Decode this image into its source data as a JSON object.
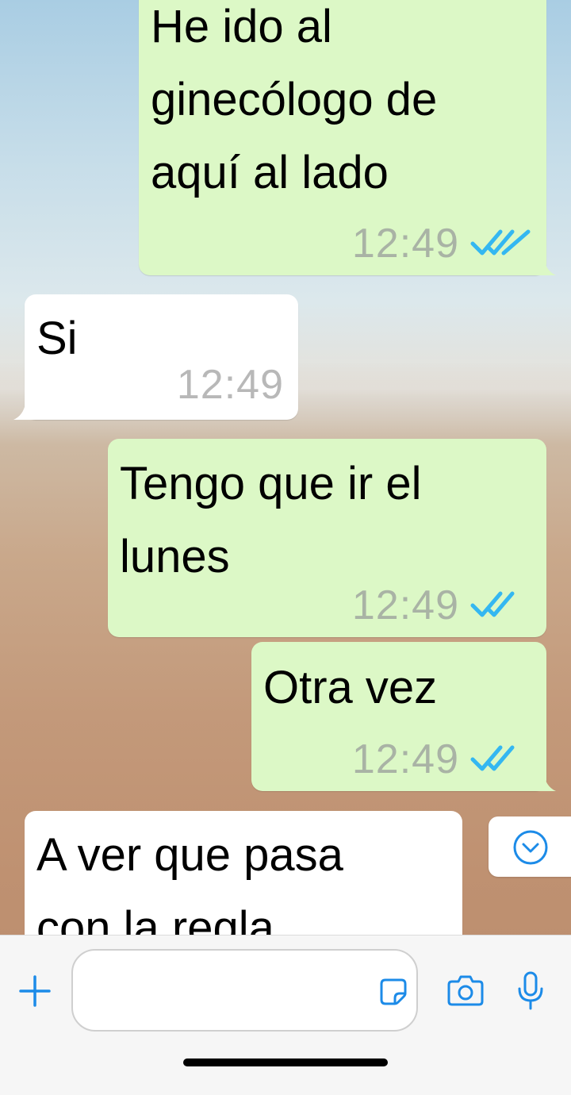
{
  "conversation": {
    "messages": [
      {
        "direction": "outgoing",
        "text": "He ido al\nginecólogo de\naquí al lado",
        "time": "12:49",
        "status": "read"
      },
      {
        "direction": "incoming",
        "text": "Si",
        "time": "12:49"
      },
      {
        "direction": "outgoing",
        "text": "Tengo que ir el\nlunes",
        "time": "12:49",
        "status": "read"
      },
      {
        "direction": "outgoing",
        "text": "Otra vez",
        "time": "12:49",
        "status": "read"
      },
      {
        "direction": "incoming",
        "text": "A ver que pasa\ncon la regla",
        "time": ""
      }
    ]
  },
  "scroll_button": {
    "icon": "chevron-down-icon"
  },
  "composer": {
    "attach_icon": "plus-icon",
    "input_value": "",
    "sticker_icon": "sticker-icon",
    "camera_icon": "camera-icon",
    "mic_icon": "microphone-icon"
  },
  "colors": {
    "outgoing_bubble": "#dcf8c6",
    "incoming_bubble": "#ffffff",
    "read_ticks": "#34b7f1",
    "accent": "#1c8be8"
  }
}
